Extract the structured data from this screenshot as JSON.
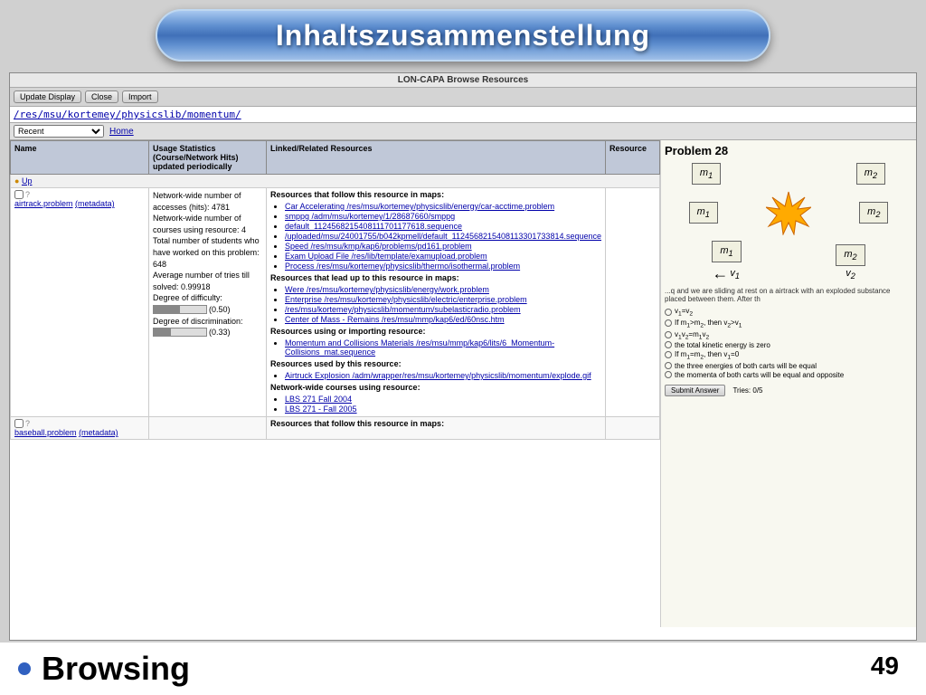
{
  "title": {
    "text": "Inhaltszusammenstellung"
  },
  "browser": {
    "window_title": "LON-CAPA Browse Resources",
    "toolbar": {
      "update_display": "Update Display",
      "close": "Close",
      "import": "Import"
    },
    "path": "/res/msu/kortemey/physicslib/momentum/",
    "nav": {
      "recent_label": "Recent",
      "home": "Home"
    }
  },
  "table": {
    "headers": {
      "name": "Name",
      "usage_stats": "Usage Statistics (Course/Network Hits) updated periodically",
      "linked": "Linked/Related Resources",
      "resource": "Resource"
    },
    "up_row": {
      "label": "Up"
    },
    "row1": {
      "name_link": "airtrack.problem",
      "metadata": "(metadata)",
      "stats": "Network-wide number of accesses (hits): 4781\nNetwork-wide number of courses using resource: 4\nTotal number of students who have worked on this problem: 648\nAverage number of tries till solved: 0.99918\nDegree of difficulty: (0.50)\nDegree of discrimination: (0.33)",
      "degree_difficulty": 0.5,
      "degree_discrimination": 0.33,
      "linked_follows_title": "Resources that follow this resource in maps:",
      "linked_follows": [
        "Car Accelerating /res/msu/kortemey/physicslib/energy/car-acctime.problem",
        "smppg /adm/msu/kortemey/1/28687660/smppg",
        "default_1124568215408111701177618.sequence",
        "/uploaded/msu/24001755/b042kpmell/default_1124568215408113301733814.sequence",
        "Speed /res/msu/kmp/kap6/problems/pd161.problem",
        "Exam Upload File /res/lib/template/examupload.problem",
        "Process /res/msu/kortemey/physicslib/thermo/isothermal.problem"
      ],
      "linked_leads_title": "Resources that lead up to this resource in maps:",
      "linked_leads": [
        "Were /res/msu/kortemey/physicslib/energy/work.problem",
        "Enterprise /res/msu/kortemey/physicslib/electric/enterprise.problem",
        "/res/msu/kortemey/physicslib/momentum/subelasticradio.problem",
        "Center of Mass - Remains /res/msu/mmp/kap6/ed/60nsc.htm"
      ],
      "linked_using_title": "Resources using or importing resource:",
      "linked_using": [
        "Momentum and Collisions Materials /res/msu/mmp/kap6/lits/6_Momentum-Collisions_mat.sequence"
      ],
      "linked_used_title": "Resources used by this resource:",
      "linked_used": [
        "Airtruck Explosion /adm/wrapper/res/msu/kortemey/physicslib/momentum/explode.gif"
      ],
      "network_courses_title": "Network-wide courses using resource:",
      "network_courses": [
        "LBS 271 Fall 2004",
        "LBS 271 - Fall 2005"
      ]
    },
    "row2": {
      "name_link": "baseball.problem",
      "metadata": "(metadata)",
      "linked_follows_title": "Resources that follow this resource in maps:"
    }
  },
  "problem28": {
    "title": "Problem 28",
    "diagram1": {
      "m1": "m₁",
      "m2": "m₂"
    },
    "diagram2": {
      "m1": "m₁",
      "m2": "m₂",
      "explosion_symbol": "💥"
    },
    "diagram3": {
      "m1": "m₁",
      "m2": "m₂",
      "v1": "v₁",
      "v2": "v₂"
    },
    "description": "...q and we are sliding at rest on a airtrack with an exploded substance placed between them. After th",
    "options": [
      "v₁=v₂",
      "If m₁>m₂, then v₂>v₁",
      "v₁v₂=m₁v₂",
      "the total kinetic energy is zero",
      "If m₁=m₂, then v₁=0",
      "the three energies of both carts will be equal",
      "the momenta of both carts will be equal and opposite"
    ],
    "submit_btn": "Submit Answer",
    "tries_label": "Tries: 0/5"
  },
  "bottom": {
    "browsing_label": "Browsing",
    "page_number": "49"
  }
}
